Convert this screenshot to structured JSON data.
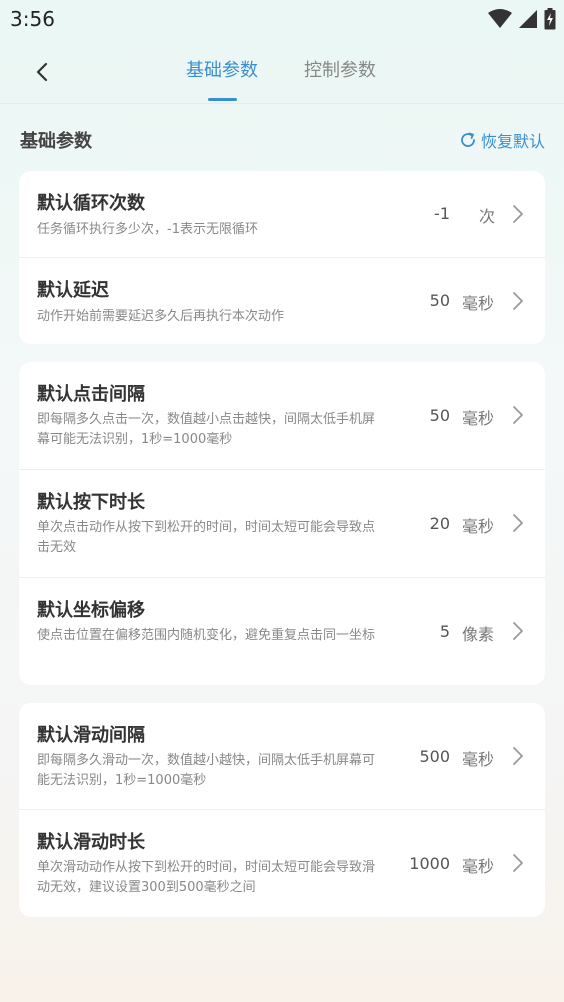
{
  "status": {
    "time": "3:56"
  },
  "nav": {
    "tabs": [
      {
        "label": "基础参数",
        "active": true
      },
      {
        "label": "控制参数",
        "active": false
      }
    ]
  },
  "section": {
    "title": "基础参数",
    "restore_label": "恢复默认"
  },
  "groups": [
    {
      "items": [
        {
          "title": "默认循环次数",
          "desc": "任务循环执行多少次，-1表示无限循环",
          "value": "-1",
          "unit": "次"
        },
        {
          "title": "默认延迟",
          "desc": "动作开始前需要延迟多久后再执行本次动作",
          "value": "50",
          "unit": "毫秒"
        }
      ]
    },
    {
      "items": [
        {
          "title": "默认点击间隔",
          "desc": "即每隔多久点击一次，数值越小点击越快，间隔太低手机屏幕可能无法识别，1秒=1000毫秒",
          "value": "50",
          "unit": "毫秒"
        },
        {
          "title": "默认按下时长",
          "desc": "单次点击动作从按下到松开的时间，时间太短可能会导致点击无效",
          "value": "20",
          "unit": "毫秒"
        },
        {
          "title": "默认坐标偏移",
          "desc": "使点击位置在偏移范围内随机变化，避免重复点击同一坐标",
          "value": "5",
          "unit": "像素"
        }
      ]
    },
    {
      "items": [
        {
          "title": "默认滑动间隔",
          "desc": "即每隔多久滑动一次，数值越小越快，间隔太低手机屏幕可能无法识别，1秒=1000毫秒",
          "value": "500",
          "unit": "毫秒"
        },
        {
          "title": "默认滑动时长",
          "desc": "单次滑动动作从按下到松开的时间，时间太短可能会导致滑动无效，建议设置300到500毫秒之间",
          "value": "1000",
          "unit": "毫秒"
        }
      ]
    }
  ],
  "colors": {
    "accent": "#3a8fd1"
  }
}
